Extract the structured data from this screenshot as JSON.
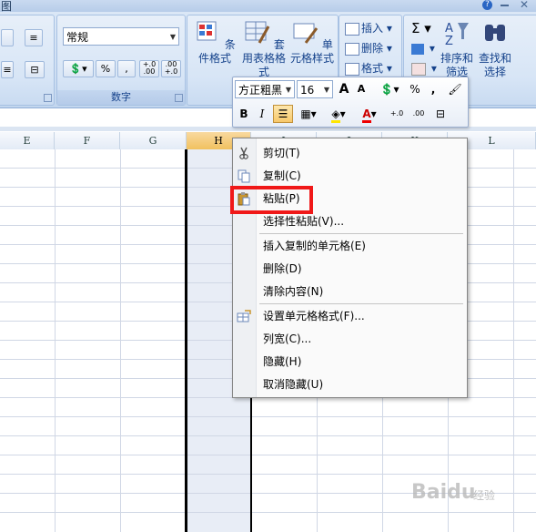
{
  "titlebar": {
    "title_fragment": "图"
  },
  "ribbon": {
    "number_format": "常规",
    "number_group_label": "数字",
    "percent_label": "%",
    "comma_label": ",",
    "increase_decimal": "+.0 .00",
    "decrease_decimal": ".00 +.0",
    "conditional_format_label": "条件格式",
    "table_format_label": "套用表格格式",
    "cell_styles_label": "单元格样式",
    "insert_label": "插入",
    "delete_label": "删除",
    "format_label": "格式",
    "sigma_label": "Σ",
    "sort_filter_label": "排序和筛选",
    "find_select_label": "查找和选择"
  },
  "mini_toolbar": {
    "font_name": "方正粗黑",
    "font_size": "16",
    "grow_font": "A",
    "shrink_font": "A",
    "percent": "%",
    "comma": ",",
    "bold": "B",
    "italic": "I",
    "font_color_letter": "A"
  },
  "columns": [
    {
      "label": "E"
    },
    {
      "label": "F"
    },
    {
      "label": "G"
    },
    {
      "label": "H"
    },
    {
      "label": "I"
    },
    {
      "label": "J"
    },
    {
      "label": "K"
    },
    {
      "label": "L"
    }
  ],
  "context_menu": {
    "items": [
      {
        "label": "剪切(T)"
      },
      {
        "label": "复制(C)"
      },
      {
        "label": "粘贴(P)"
      },
      {
        "label": "选择性粘贴(V)..."
      },
      {
        "label": "插入复制的单元格(E)"
      },
      {
        "label": "删除(D)"
      },
      {
        "label": "清除内容(N)"
      },
      {
        "label": "设置单元格格式(F)..."
      },
      {
        "label": "列宽(C)..."
      },
      {
        "label": "隐藏(H)"
      },
      {
        "label": "取消隐藏(U)"
      }
    ]
  },
  "watermark": {
    "brand": "Baidu",
    "sub": "经验"
  },
  "colors": {
    "highlight": "#f01818",
    "selected_header": "#f1c15f",
    "ribbon_text": "#15428b"
  }
}
